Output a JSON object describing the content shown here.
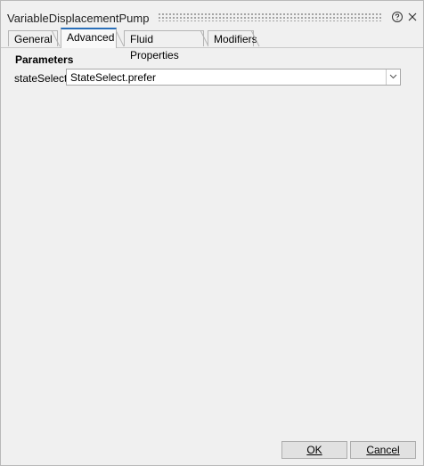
{
  "window": {
    "title": "VariableDisplacementPump"
  },
  "tabs": [
    {
      "label": "General",
      "active": false
    },
    {
      "label": "Advanced",
      "active": true
    },
    {
      "label": "Fluid Properties",
      "active": false
    },
    {
      "label": "Modifiers",
      "active": false
    }
  ],
  "parameters": {
    "section_title": "Parameters",
    "rows": [
      {
        "label": "stateSelect",
        "value": "StateSelect.prefer"
      }
    ]
  },
  "buttons": {
    "ok_label": "OK",
    "cancel_label": "Cancel"
  },
  "icons": {
    "help": "help-circle-icon",
    "close": "close-icon",
    "dropdown": "chevron-down-icon"
  },
  "colors": {
    "active_tab_accent": "#2a6fb9",
    "background": "#f0f0f0"
  }
}
